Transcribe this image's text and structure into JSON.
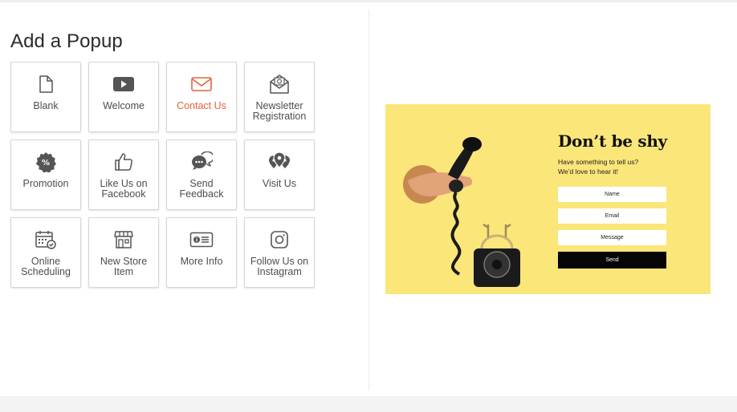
{
  "panel": {
    "title": "Add a Popup",
    "templates": [
      {
        "label": "Blank",
        "icon": "document-icon"
      },
      {
        "label": "Welcome",
        "icon": "play-icon"
      },
      {
        "label": "Contact Us",
        "icon": "envelope-icon",
        "selected": true
      },
      {
        "label": "Newsletter Registration",
        "icon": "newsletter-icon"
      },
      {
        "label": "Promotion",
        "icon": "percent-badge-icon"
      },
      {
        "label": "Like Us on Facebook",
        "icon": "thumbs-up-icon"
      },
      {
        "label": "Send Feedback",
        "icon": "chat-bubbles-icon"
      },
      {
        "label": "Visit Us",
        "icon": "map-pins-icon"
      },
      {
        "label": "Online Scheduling",
        "icon": "calendar-check-icon"
      },
      {
        "label": "New Store Item",
        "icon": "storefront-icon"
      },
      {
        "label": "More Info",
        "icon": "info-card-icon"
      },
      {
        "label": "Follow Us on Instagram",
        "icon": "instagram-icon"
      }
    ]
  },
  "preview": {
    "title": "Don’t be shy",
    "subtitle_line1": "Have something to tell us?",
    "subtitle_line2": "We’d love to hear it!",
    "name_placeholder": "Name",
    "email_placeholder": "Email",
    "message_placeholder": "Message",
    "send_label": "Send",
    "background_color": "#fbe67a",
    "accent_color": "#e4623c"
  }
}
